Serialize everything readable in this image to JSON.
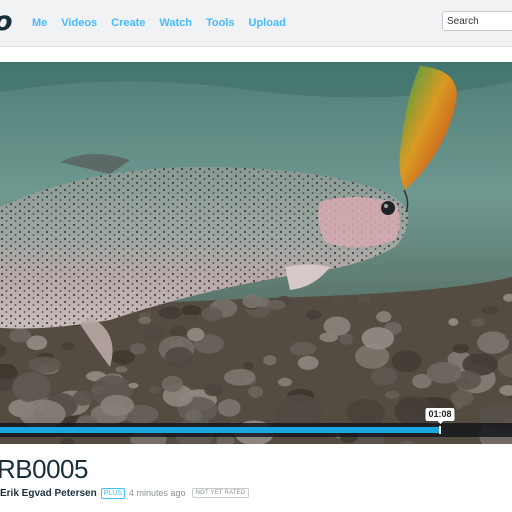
{
  "header": {
    "logo": "o",
    "nav": [
      "Me",
      "Videos",
      "Create",
      "Watch",
      "Tools",
      "Upload"
    ],
    "search_placeholder": "Search"
  },
  "player": {
    "current_time": "01:08",
    "progress_fraction": 0.86
  },
  "video": {
    "title": "RB0005",
    "author": "Erik Egvad Petersen",
    "plus_badge": "PLUS",
    "uploaded": "4 minutes ago",
    "rating": "NOT YET RATED"
  },
  "colors": {
    "accent": "#44bbff",
    "progress": "#1aa7e0",
    "text_dark": "#1a2e3b"
  }
}
